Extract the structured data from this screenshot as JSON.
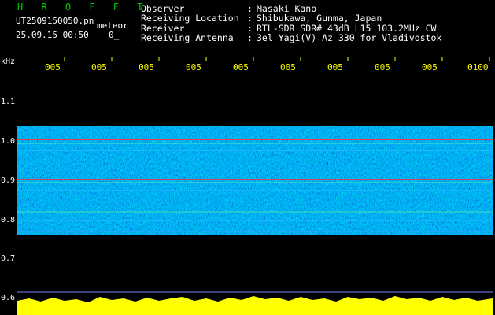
{
  "header": {
    "title": "H R O F F T",
    "filename": "UT2509150050.pn",
    "type": "meteor",
    "datetime": "25.09.15 00:50",
    "flag": "0_"
  },
  "info": [
    {
      "label": "Observer",
      "value": "Masaki Kano"
    },
    {
      "label": "Receiving Location",
      "value": "Shibukawa, Gunma, Japan"
    },
    {
      "label": "Receiver",
      "value": "RTL-SDR SDR# 43dB L15 103.2MHz CW"
    },
    {
      "label": "Receiving Antenna",
      "value": "3el Yagi(V) Az 330 for Vladivostok"
    }
  ],
  "separator": ":",
  "axis": {
    "unit": "kHz",
    "time_ticks": [
      "005",
      "005",
      "005",
      "005",
      "005",
      "005",
      "005",
      "005",
      "005",
      "0100"
    ],
    "freq_ticks": [
      "1.1",
      "1.0",
      "0.9",
      "0.8",
      "0.7",
      "0.6"
    ]
  },
  "colors": {
    "background": "#000000",
    "title": "#00c800",
    "text": "#ffffff",
    "ticks": "#ffff00",
    "spectrum_bg": "#000080",
    "signal": "#ff3030",
    "level": "#ffff00"
  }
}
